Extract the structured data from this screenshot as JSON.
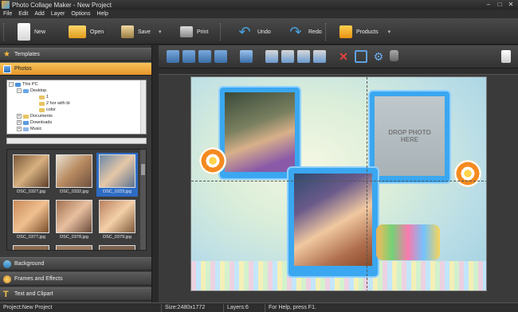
{
  "window": {
    "title": "Photo Collage Maker - New Project"
  },
  "menu": [
    "File",
    "Edit",
    "Add",
    "Layer",
    "Options",
    "Help"
  ],
  "toolbar": {
    "new": "New",
    "open": "Open",
    "save": "Save",
    "print": "Print",
    "undo": "Undo",
    "redo": "Redo",
    "products": "Products"
  },
  "panels": {
    "templates": "Templates",
    "photos": "Photos",
    "background": "Background",
    "frames": "Frames and Effects",
    "text": "Text and Clipart"
  },
  "tree": [
    {
      "label": "This PC",
      "level": 0,
      "exp": "−"
    },
    {
      "label": "Desktop",
      "level": 1,
      "exp": "−"
    },
    {
      "label": "1",
      "level": 2,
      "exp": ""
    },
    {
      "label": "2 hor with bl",
      "level": 2,
      "exp": ""
    },
    {
      "label": "color",
      "level": 2,
      "exp": ""
    },
    {
      "label": "Documents",
      "level": 1,
      "exp": "+"
    },
    {
      "label": "Downloads",
      "level": 1,
      "exp": "+"
    },
    {
      "label": "Music",
      "level": 1,
      "exp": "+"
    }
  ],
  "thumbnails": [
    {
      "caption": "DSC_0327.jpg",
      "selected": false
    },
    {
      "caption": "DSC_0332.jpg",
      "selected": false
    },
    {
      "caption": "DSC_0333.jpg",
      "selected": true
    },
    {
      "caption": "DSC_0377.jpg",
      "selected": false
    },
    {
      "caption": "DSC_0378.jpg",
      "selected": false
    },
    {
      "caption": "DSC_0379.jpg",
      "selected": false
    }
  ],
  "canvas": {
    "drop_text_1": "DROP PHOTO",
    "drop_text_2": "HERE"
  },
  "status": {
    "project": "Project:New Project",
    "size": "Size:2480x1772",
    "layers": "Layers:6",
    "help": "For Help, press F1."
  },
  "colors": {
    "accent": "#f0a63a",
    "selection": "#2d6bc4",
    "frame_blue": "#3aa7f0"
  }
}
